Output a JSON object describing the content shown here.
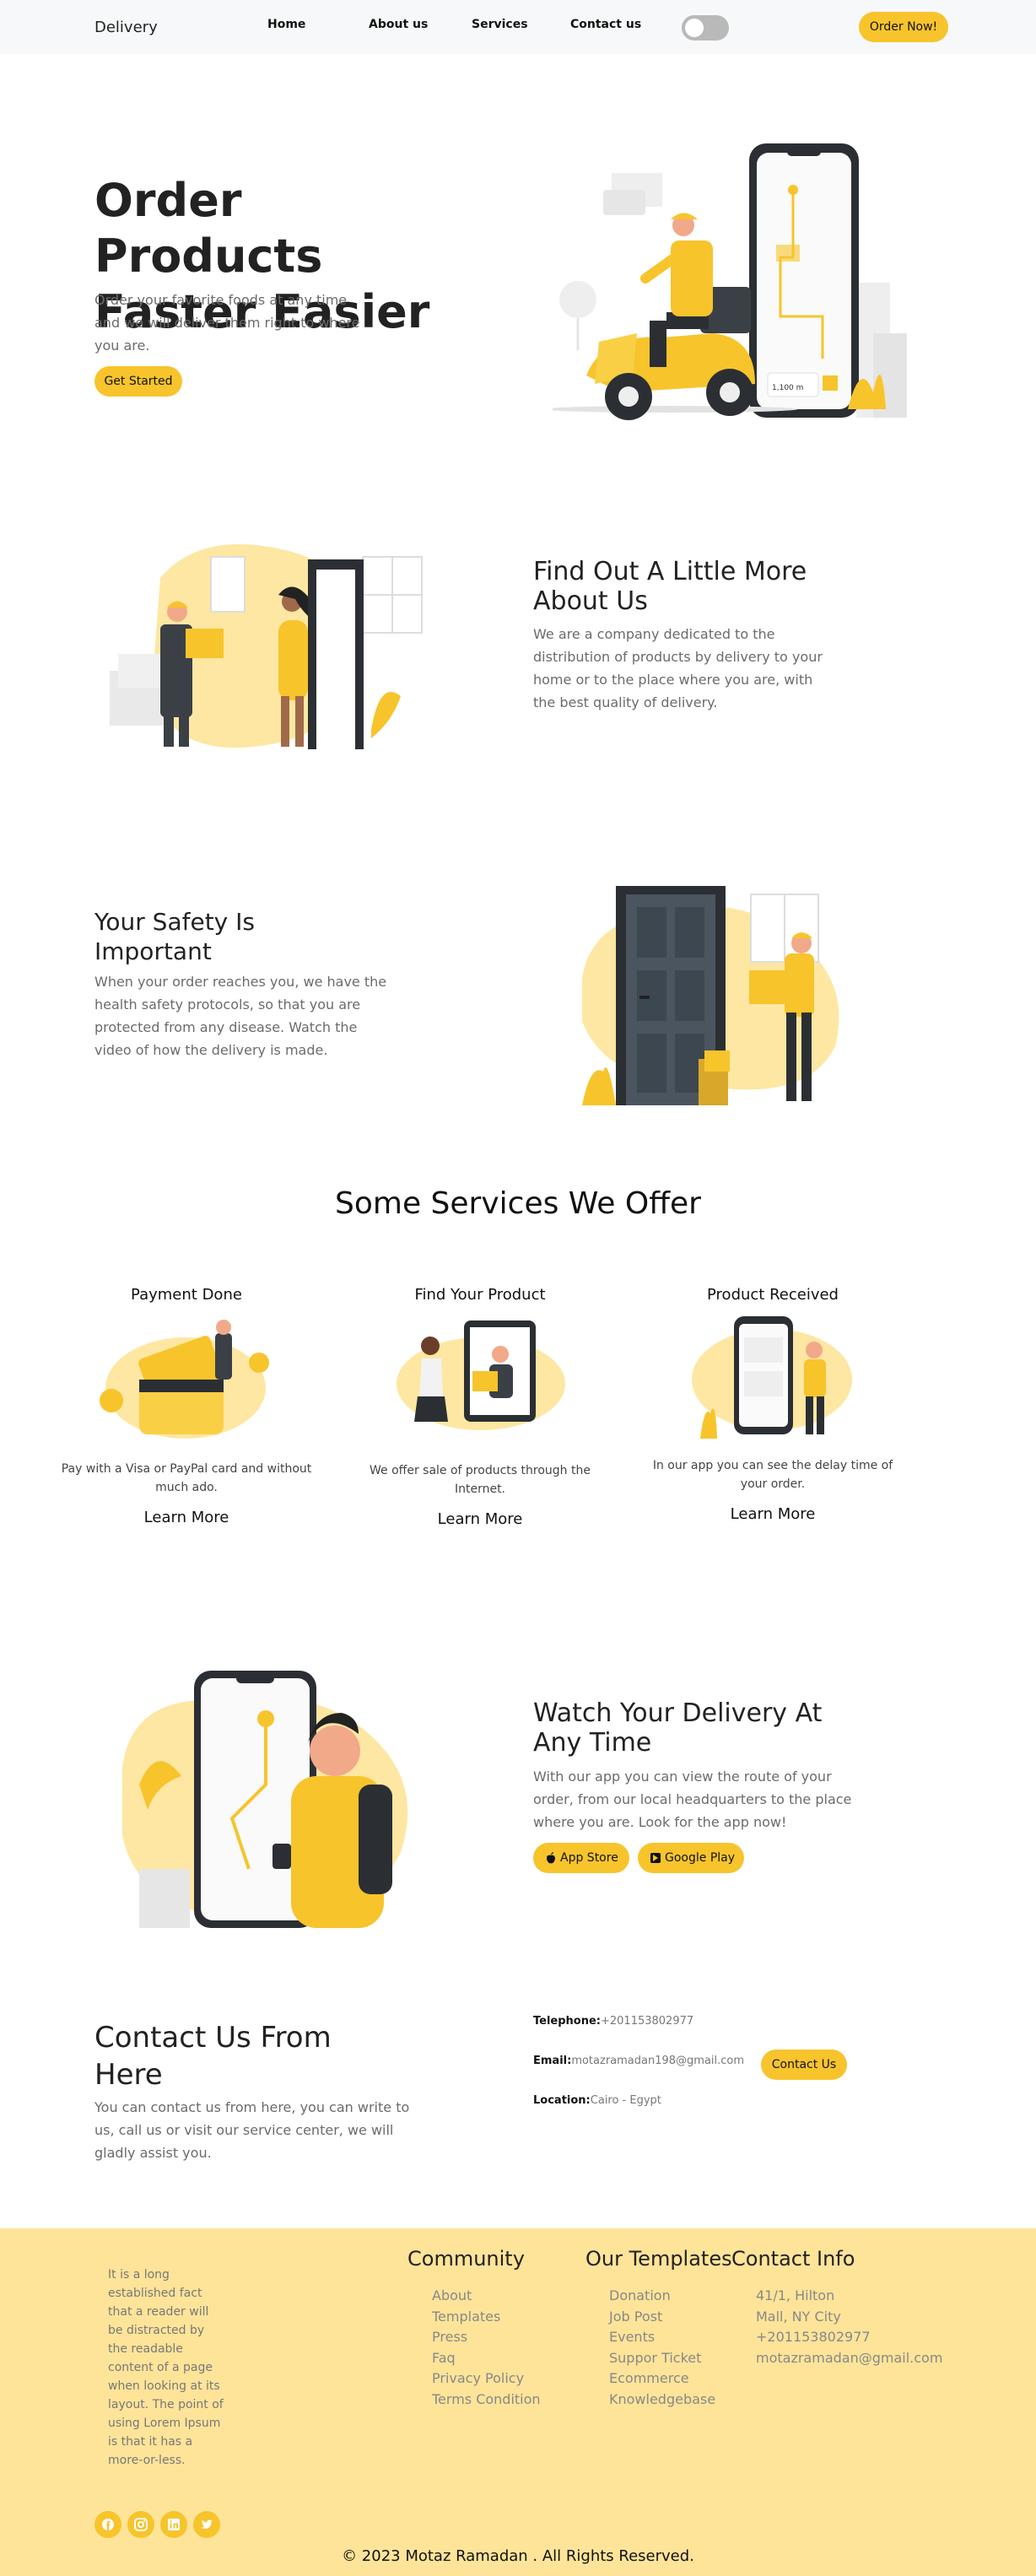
{
  "nav": {
    "brand": "Delivery",
    "links": [
      "Home",
      "About us",
      "Services",
      "Contact us"
    ],
    "order_button": "Order Now!"
  },
  "hero": {
    "title": "Order Products Faster Easier",
    "text": "Order your favorite foods at any time and we will deliver them right to where you are.",
    "cta": "Get Started",
    "phone_distance": "1,100 m"
  },
  "about": {
    "title": "Find Out A Little More About Us",
    "text": "We are a company dedicated to the distribution of products by delivery to your home or to the place where you are, with the best quality of delivery."
  },
  "safety": {
    "title": "Your Safety Is Important",
    "text": "When your order reaches you, we have the health safety protocols, so that you are protected from any disease. Watch the video of how the delivery is made."
  },
  "services": {
    "title": "Some Services We Offer",
    "items": [
      {
        "name": "Payment Done",
        "desc": "Pay with a Visa or PayPal card and without much ado.",
        "more": "Learn More"
      },
      {
        "name": "Find Your Product",
        "desc": "We offer sale of products through the Internet.",
        "more": "Learn More"
      },
      {
        "name": "Product Received",
        "desc": "In our app you can see the delay time of your order.",
        "more": "Learn More"
      }
    ]
  },
  "app": {
    "title": "Watch Your Delivery At Any Time",
    "text": "With our app you can view the route of your order, from our local headquarters to the place where you are. Look for the app now!",
    "app_store": "App Store",
    "google_play": "Google Play"
  },
  "contact": {
    "title": "Contact Us From Here",
    "text": "You can contact us from here, you can write to us, call us or visit our service center, we will gladly assist you.",
    "telephone_label": "Telephone:",
    "telephone": "+201153802977",
    "email_label": "Email:",
    "email": "motazramadan198@gmail.com",
    "location_label": "Location:",
    "location": "Cairo - Egypt",
    "button": "Contact Us"
  },
  "footer": {
    "about": "It is a long established fact that a reader will be distracted by the readable content of a page when looking at its layout. The point of using Lorem Ipsum is that it has a more-or-less.",
    "community": {
      "title": "Community",
      "items": [
        "About",
        "Templates",
        "Press",
        "Faq",
        "Privacy Policy",
        "Terms Condition"
      ]
    },
    "templates": {
      "title": "Our Templates",
      "items": [
        "Donation",
        "Job Post",
        "Events",
        "Suppor Ticket",
        "Ecommerce",
        "Knowledgebase"
      ]
    },
    "contact": {
      "title": "Contact Info",
      "items": [
        "41/1, Hilton",
        "Mall, NY City",
        "+201153802977",
        "motazramadan@gmail.com"
      ]
    },
    "social": [
      "facebook-icon",
      "instagram-icon",
      "linkedin-icon",
      "twitter-icon"
    ],
    "copyright": "© 2023 Motaz Ramadan . All Rights Reserved."
  },
  "colors": {
    "accent": "#f7c42c",
    "footer_bg": "#fee499",
    "dark": "#2b2f33"
  }
}
